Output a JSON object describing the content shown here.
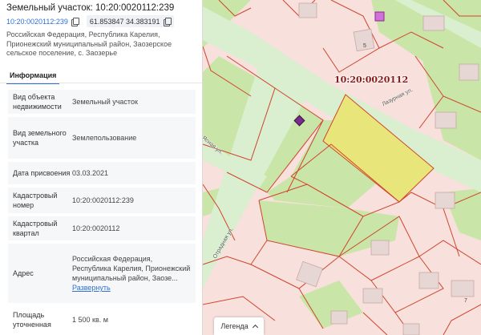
{
  "panel": {
    "title": "Земельный участок: 10:20:0020112:239",
    "cad_number": "10:20:0020112:239",
    "coords": "61.853847 34.383191",
    "address_short": "Российская Федерация, Республика Карелия, Прионежский муниципальный район, Заозерское сельское поселение, с. Заозерье",
    "tabs": [
      {
        "label": "Информация",
        "active": true
      }
    ],
    "rows": [
      {
        "key": "Вид объекта недвижимости",
        "value": "Земельный участок"
      },
      {
        "key": "Вид земельного участка",
        "value": "Землепользование"
      },
      {
        "key": "Дата присвоения",
        "value": "03.03.2021"
      },
      {
        "key": "Кадастровый номер",
        "value": "10:20:0020112:239"
      },
      {
        "key": "Кадастровый квартал",
        "value": "10:20:0020112"
      },
      {
        "key": "Адрес",
        "value": "Российская Федерация, Республика Карелия, Прионежский муниципальный район, Заозе...",
        "link": "Развернуть"
      },
      {
        "key": "Площадь уточненная",
        "value": "1 500 кв. м"
      }
    ]
  },
  "map": {
    "quarter_label": "10:20:0020112",
    "streets": [
      "Лазурная ул.",
      "Отрадная ул.",
      "Ясная ул."
    ],
    "house_numbers": [
      "5",
      "7"
    ],
    "legend_label": "Легенда",
    "colors": {
      "parcel_fill": "#f8e0dc",
      "parcel_border": "#d0442c",
      "road": "#d9efcf",
      "green": "#c9e6a8",
      "selected": "#e8e57a",
      "building": "#e6d6d4",
      "marker": "#7a2a8a"
    }
  }
}
